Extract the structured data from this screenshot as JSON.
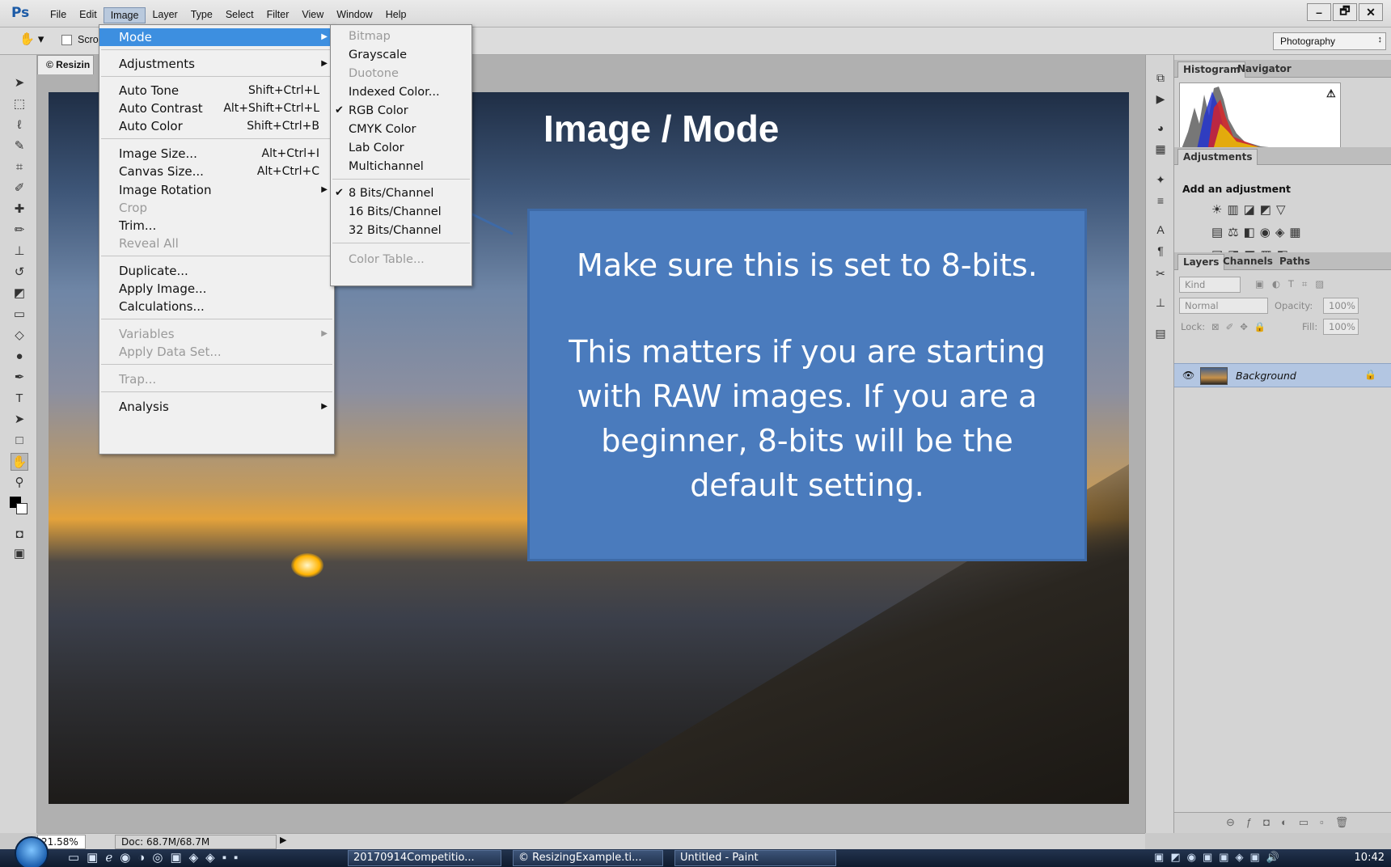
{
  "app": {
    "logo": "Ps"
  },
  "menubar": {
    "items": [
      "File",
      "Edit",
      "Image",
      "Layer",
      "Type",
      "Select",
      "Filter",
      "View",
      "Window",
      "Help"
    ],
    "active": "Image"
  },
  "window_controls": {
    "minimize": "–",
    "restore": "🗗",
    "close": "✕"
  },
  "options_bar": {
    "hand_icon": "hand-icon",
    "scroll_label": "Scro",
    "workspace": "Photography"
  },
  "document": {
    "tab_title": "© Resizin",
    "zoom": "21.58%",
    "doc_size": "Doc: 68.7M/68.7M"
  },
  "annotation": {
    "title": "Image / Mode",
    "note_line1": "Make sure this is set to 8-bits.",
    "note_line2": "This matters if you are starting with RAW images. If you are a beginner, 8-bits will be the default setting."
  },
  "image_menu": {
    "mode": "Mode",
    "adjustments": "Adjustments",
    "auto_tone": {
      "label": "Auto Tone",
      "shortcut": "Shift+Ctrl+L"
    },
    "auto_contrast": {
      "label": "Auto Contrast",
      "shortcut": "Alt+Shift+Ctrl+L"
    },
    "auto_color": {
      "label": "Auto Color",
      "shortcut": "Shift+Ctrl+B"
    },
    "image_size": {
      "label": "Image Size...",
      "shortcut": "Alt+Ctrl+I"
    },
    "canvas_size": {
      "label": "Canvas Size...",
      "shortcut": "Alt+Ctrl+C"
    },
    "image_rotation": "Image Rotation",
    "crop": "Crop",
    "trim": "Trim...",
    "reveal_all": "Reveal All",
    "duplicate": "Duplicate...",
    "apply_image": "Apply Image...",
    "calculations": "Calculations...",
    "variables": "Variables",
    "apply_data_set": "Apply Data Set...",
    "trap": "Trap...",
    "analysis": "Analysis"
  },
  "mode_menu": {
    "bitmap": "Bitmap",
    "grayscale": "Grayscale",
    "duotone": "Duotone",
    "indexed_color": "Indexed Color...",
    "rgb_color": "RGB Color",
    "cmyk_color": "CMYK Color",
    "lab_color": "Lab Color",
    "multichannel": "Multichannel",
    "bits8": "8 Bits/Channel",
    "bits16": "16 Bits/Channel",
    "bits32": "32 Bits/Channel",
    "color_table": "Color Table...",
    "check": "✔"
  },
  "panels": {
    "histogram_tab": "Histogram",
    "navigator_tab": "Navigator",
    "warning_icon": "⚠",
    "adjustments_tab": "Adjustments",
    "add_adjustment": "Add an adjustment",
    "layers_tab": "Layers",
    "channels_tab": "Channels",
    "paths_tab": "Paths",
    "kind": "Kind",
    "blend_mode": "Normal",
    "opacity_label": "Opacity:",
    "opacity_value": "100%",
    "lock_label": "Lock:",
    "fill_label": "Fill:",
    "fill_value": "100%",
    "layer_name": "Background"
  },
  "taskbar": {
    "btn1": "20170914Competitio...",
    "btn2": "© ResizingExample.ti...",
    "btn3": "Untitled - Paint",
    "clock": "10:42"
  }
}
